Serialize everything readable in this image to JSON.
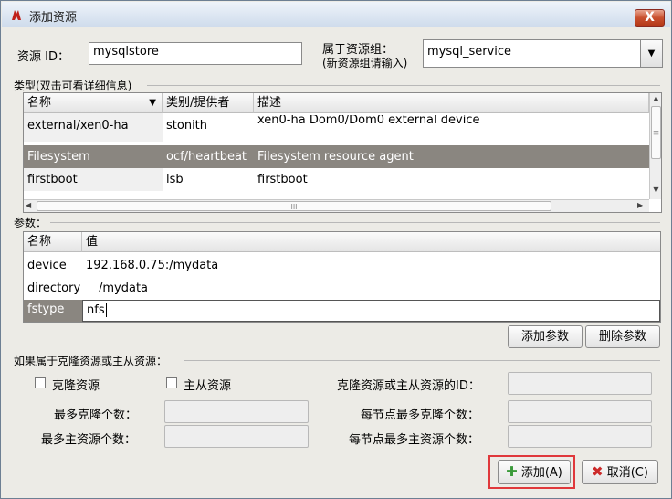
{
  "window": {
    "title": "添加资源",
    "close_glyph": "X"
  },
  "resource_id": {
    "label": "资源 ID：",
    "value": "mysqlstore"
  },
  "group": {
    "label_line1": "属于资源组：",
    "label_line2": "(新资源组请输入)",
    "value": "mysql_service"
  },
  "type_section": {
    "title": "类型(双击可看详细信息)",
    "columns": [
      "名称",
      "类别/提供者",
      "描述"
    ],
    "rows": [
      {
        "name": "external/xen0-ha",
        "class": "stonith",
        "desc": "xen0-ha Dom0/Dom0 external device"
      },
      {
        "name": "Filesystem",
        "class": "ocf/heartbeat",
        "desc": "Filesystem resource agent"
      },
      {
        "name": "firstboot",
        "class": "lsb",
        "desc": "firstboot"
      }
    ],
    "selected_row": 1,
    "hscroll_grip": "III",
    "vscroll_grip": "≡"
  },
  "params_section": {
    "title": "参数：",
    "columns": [
      "名称",
      "值"
    ],
    "rows": [
      {
        "name": "device",
        "value": "192.168.0.75:/mydata"
      },
      {
        "name": "directory",
        "value": "/mydata"
      },
      {
        "name": "fstype",
        "value": "nfs"
      }
    ],
    "add_button": "添加参数",
    "delete_button": "删除参数"
  },
  "clone_section": {
    "title": "如果属于克隆资源或主从资源：",
    "clone_checkbox": "克隆资源",
    "master_checkbox": "主从资源",
    "id_label": "克隆资源或主从资源的ID：",
    "max_clone_label": "最多克隆个数：",
    "max_master_label": "最多主资源个数：",
    "node_max_clone_label": "每节点最多克隆个数：",
    "node_max_master_label": "每节点最多主资源个数："
  },
  "buttons": {
    "add": "添加(A)",
    "cancel": "取消(C)"
  },
  "colors": {
    "highlight_border": "#e0383b",
    "selected_row": "#8a8680",
    "add_icon": "#3a9a3a",
    "cancel_icon": "#cc2a2a"
  }
}
